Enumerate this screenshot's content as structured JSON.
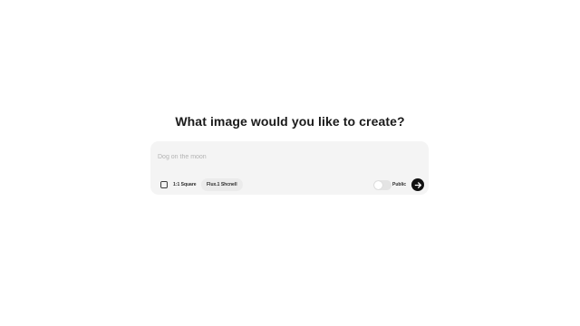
{
  "heading": "What image would you like to create?",
  "prompt": {
    "value": "",
    "placeholder": "Dog on the moon"
  },
  "options": {
    "aspect_ratio": "1:1 Square",
    "model": "Flux.1 Shcnell",
    "public_label": "Public",
    "public_enabled": false
  },
  "icons": {
    "aspect": "square-aspect-icon",
    "submit": "arrow-right-icon"
  },
  "colors": {
    "submit_bg": "#111111",
    "card_bg": "#f4f4f4"
  }
}
